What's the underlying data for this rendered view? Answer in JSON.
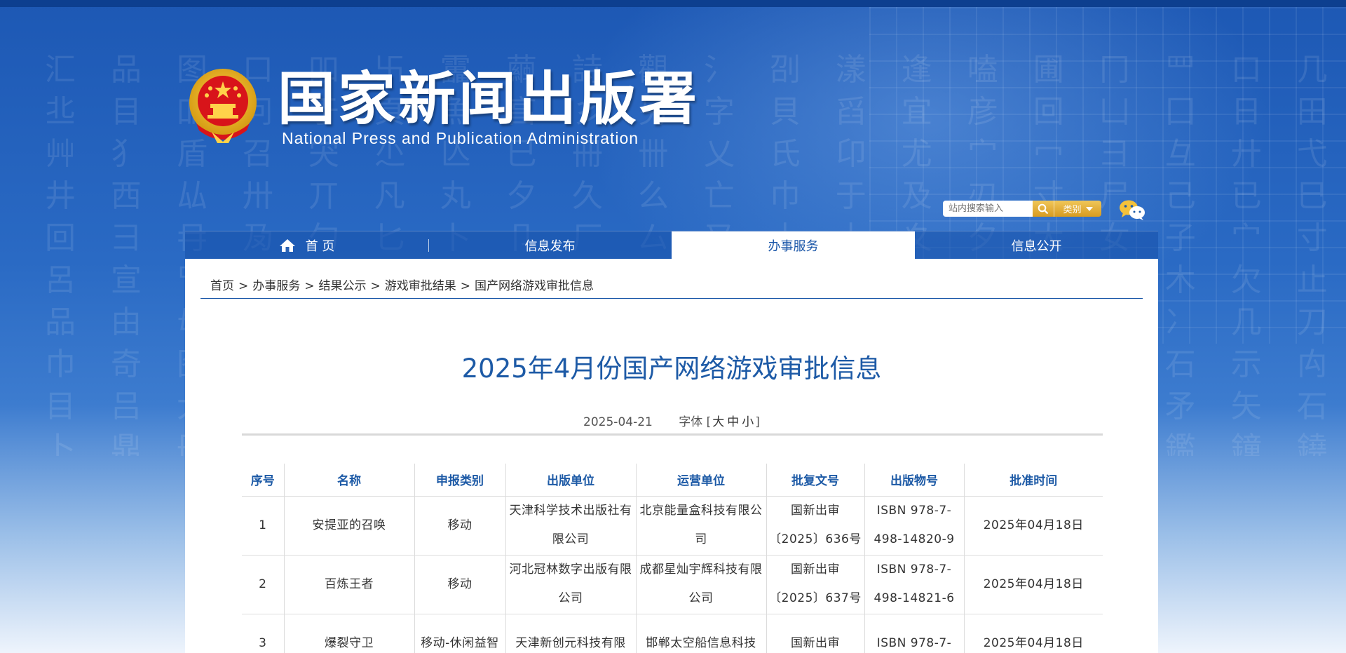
{
  "site": {
    "title": "国家新闻出版署",
    "subtitle": "National  Press and Publication Administration"
  },
  "search": {
    "placeholder": "站内搜索输入",
    "category_label": "类别",
    "icons": [
      "search-icon",
      "wechat-icon",
      "home-icon",
      "chevron-down-icon"
    ]
  },
  "nav": {
    "items": [
      {
        "label": "首 页"
      },
      {
        "label": "信息发布"
      },
      {
        "label": "办事服务"
      },
      {
        "label": "信息公开"
      }
    ],
    "active_index": 2
  },
  "breadcrumb": {
    "items": [
      "首页",
      "办事服务",
      "结果公示",
      "游戏审批结果",
      "国产网络游戏审批信息"
    ],
    "separator": ">"
  },
  "article": {
    "title": "2025年4月份国产网络游戏审批信息",
    "date": "2025-04-21",
    "font_label": "字体",
    "font_open": "[",
    "font_large": "大",
    "font_medium": "中",
    "font_small": "小",
    "font_close": "]"
  },
  "table": {
    "headers": [
      "序号",
      "名称",
      "申报类别",
      "出版单位",
      "运营单位",
      "批复文号",
      "出版物号",
      "批准时间"
    ],
    "rows": [
      [
        "1",
        "安提亚的召唤",
        "移动",
        "天津科学技术出版社有限公司",
        "北京能量盒科技有限公司",
        "国新出审〔2025〕636号",
        "ISBN 978-7-498-14820-9",
        "2025年04月18日"
      ],
      [
        "2",
        "百炼王者",
        "移动",
        "河北冠林数字出版有限公司",
        "成都星灿宇辉科技有限公司",
        "国新出审〔2025〕637号",
        "ISBN 978-7-498-14821-6",
        "2025年04月18日"
      ],
      [
        "3",
        "爆裂守卫",
        "移动-休闲益智",
        "天津新创元科技有限",
        "邯郸太空船信息科技",
        "国新出审",
        "ISBN 978-7-",
        "2025年04月18日"
      ]
    ]
  },
  "colors": {
    "brand_blue": "#1d5aa6",
    "gold": "#d79b20"
  }
}
